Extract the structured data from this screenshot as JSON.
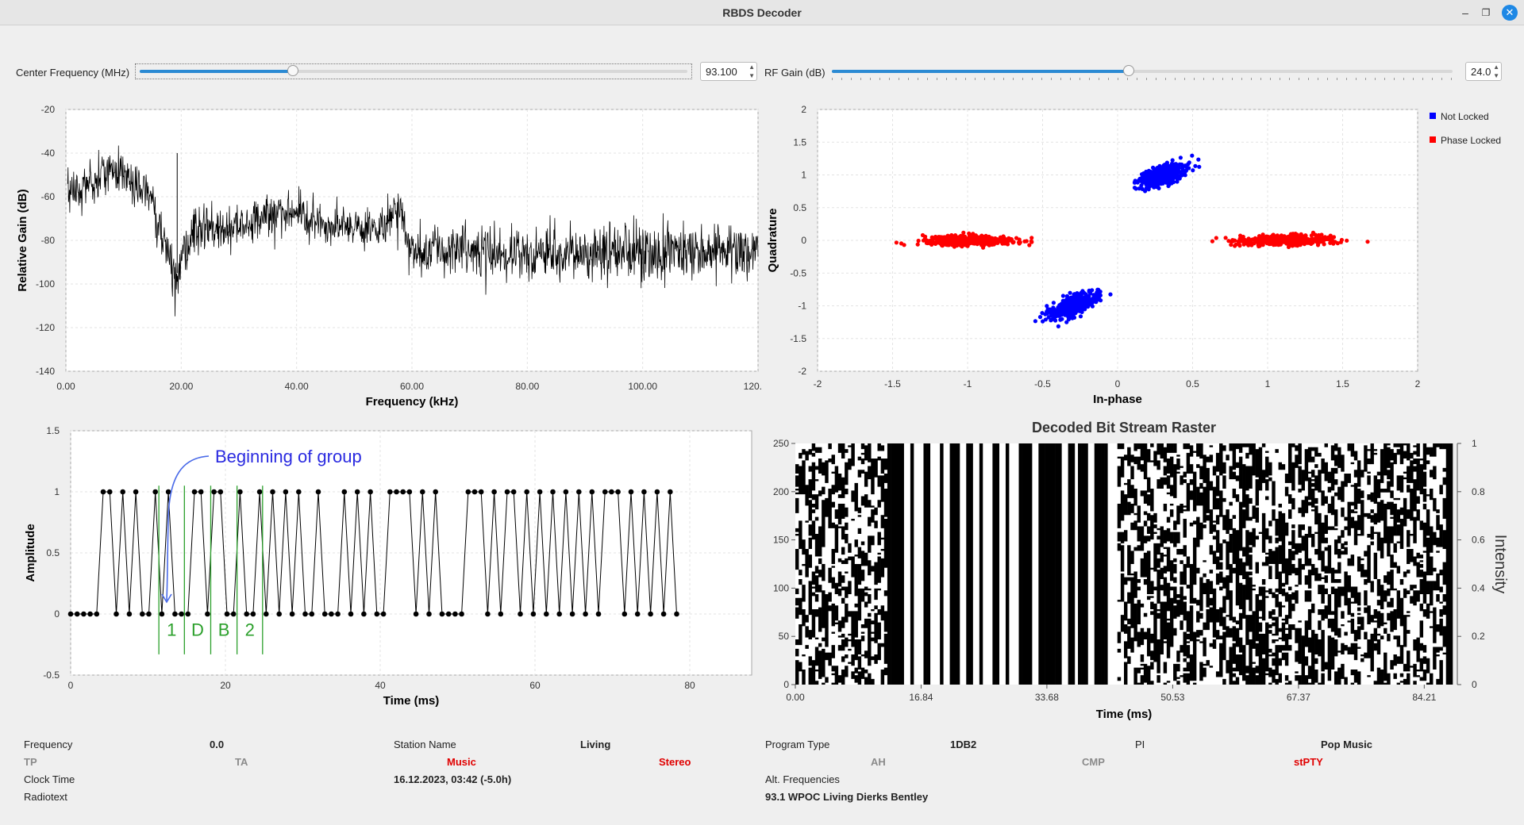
{
  "window": {
    "title": "RBDS Decoder"
  },
  "controls": {
    "center_freq_label": "Center Frequency (MHz)",
    "center_freq_value": "93.100",
    "center_freq_fraction": 0.28,
    "rf_gain_label": "RF Gain (dB)",
    "rf_gain_value": "24.0",
    "rf_gain_fraction": 0.478
  },
  "spectrum": {
    "xlabel": "Frequency (kHz)",
    "ylabel": "Relative Gain (dB)",
    "xticks": [
      "0.00",
      "20.00",
      "40.00",
      "60.00",
      "80.00",
      "100.00",
      "120.00"
    ],
    "yticks": [
      "-20",
      "-40",
      "-60",
      "-80",
      "-100",
      "-120",
      "-140"
    ]
  },
  "constellation": {
    "xlabel": "In-phase",
    "ylabel": "Quadrature",
    "xticks": [
      "-2",
      "-1.5",
      "-1",
      "-0.5",
      "0",
      "0.5",
      "1",
      "1.5",
      "2"
    ],
    "yticks": [
      "2",
      "1.5",
      "1",
      "0.5",
      "0",
      "-0.5",
      "-1",
      "-1.5",
      "-2"
    ],
    "legend": [
      {
        "name": "Not Locked",
        "color": "#0000ff"
      },
      {
        "name": "Phase Locked",
        "color": "#ff0000"
      }
    ]
  },
  "timeplot": {
    "xlabel": "Time (ms)",
    "ylabel": "Amplitude",
    "xticks": [
      "0",
      "20",
      "40",
      "60",
      "80"
    ],
    "yticks": [
      "1.5",
      "1",
      "0.5",
      "0",
      "-0.5"
    ],
    "annotation": "Beginning of group",
    "block_labels": [
      "1",
      "D",
      "B",
      "2"
    ]
  },
  "raster": {
    "title": "Decoded Bit Stream Raster",
    "xlabel": "Time (ms)",
    "right_label": "Intensity",
    "xticks": [
      "0.00",
      "16.84",
      "33.68",
      "50.53",
      "67.37",
      "84.21"
    ],
    "yticks": [
      "250",
      "200",
      "150",
      "100",
      "50",
      "0"
    ],
    "rticks": [
      "1",
      "0.8",
      "0.6",
      "0.4",
      "0.2",
      "0"
    ]
  },
  "chart_data": [
    {
      "type": "line",
      "xlabel": "Frequency (kHz)",
      "ylabel": "Relative Gain (dB)",
      "xlim": [
        0,
        120
      ],
      "ylim": [
        -140,
        -20
      ],
      "x": [
        0,
        5,
        8,
        12,
        15,
        17,
        19,
        22,
        30,
        38,
        45,
        55,
        58,
        60,
        70,
        80,
        90,
        100,
        110,
        120
      ],
      "y": [
        -60,
        -52,
        -45,
        -55,
        -60,
        -80,
        -95,
        -75,
        -75,
        -65,
        -72,
        -75,
        -62,
        -85,
        -85,
        -86,
        -85,
        -86,
        -85,
        -85
      ],
      "grid": true
    },
    {
      "type": "scatter",
      "xlabel": "In-phase",
      "ylabel": "Quadrature",
      "xlim": [
        -2,
        2
      ],
      "ylim": [
        -2,
        2
      ],
      "series": [
        {
          "name": "Not Locked",
          "clusters": [
            [
              0.3,
              1.0
            ],
            [
              -0.3,
              -1.0
            ]
          ]
        },
        {
          "name": "Phase Locked",
          "clusters": [
            [
              -1.0,
              0.0
            ],
            [
              1.1,
              0.0
            ]
          ]
        }
      ],
      "legend_position": "top-right",
      "grid": true
    },
    {
      "type": "line",
      "xlabel": "Time (ms)",
      "ylabel": "Amplitude",
      "xlim": [
        0,
        88
      ],
      "ylim": [
        -0.5,
        1.5
      ],
      "sample_spacing_ms": 0.842,
      "bits": [
        0,
        0,
        0,
        0,
        0,
        1,
        1,
        0,
        1,
        0,
        1,
        0,
        0,
        1,
        0,
        1,
        0,
        0,
        0,
        1,
        1,
        0,
        1,
        1,
        0,
        0,
        1,
        0,
        0,
        1,
        0,
        1,
        0,
        1,
        0,
        1,
        0,
        0,
        1,
        0,
        0,
        0,
        1,
        0,
        1,
        0,
        1,
        0,
        0,
        1,
        1,
        1,
        1,
        0,
        1,
        0,
        1,
        0,
        0,
        0,
        0,
        1,
        1,
        1,
        0,
        1,
        0,
        1,
        1,
        0,
        1,
        0,
        1,
        0,
        1,
        0,
        1,
        0,
        1,
        0,
        1,
        0,
        1,
        1,
        1,
        0,
        1,
        0,
        1,
        0,
        1,
        0,
        1,
        0
      ],
      "grid": true
    },
    {
      "type": "heatmap",
      "title": "Decoded Bit Stream Raster",
      "xlabel": "Time (ms)",
      "xlim": [
        0,
        88
      ],
      "ylim": [
        0,
        250
      ],
      "colorbar_label": "Intensity",
      "colorbar_range": [
        0,
        1
      ]
    }
  ],
  "info": {
    "frequency_label": "Frequency",
    "frequency_value": "0.0",
    "station_name_label": "Station Name",
    "station_name_value": "Living",
    "program_type_label": "Program Type",
    "program_type_value": "1DB2",
    "pi_label": "PI",
    "pi_value": "Pop Music",
    "tp_label": "TP",
    "ta_label": "TA",
    "music_label": "Music",
    "stereo_label": "Stereo",
    "ah_label": "AH",
    "cmp_label": "CMP",
    "stpty_label": "stPTY",
    "clock_time_label": "Clock Time",
    "clock_time_value": "16.12.2023, 03:42 (-5.0h)",
    "alt_freq_label": "Alt. Frequencies",
    "alt_freq_value": "93.1 WPOC Living Dierks Bentley",
    "radiotext_label": "Radiotext"
  }
}
